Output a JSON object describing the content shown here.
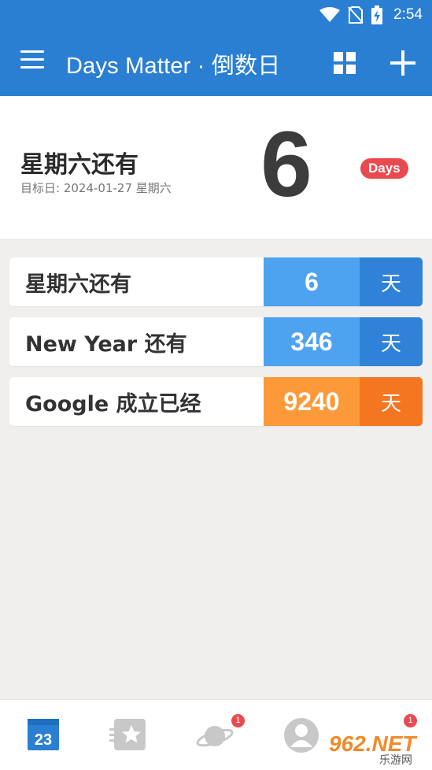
{
  "status_bar": {
    "time": "2:54"
  },
  "app_bar": {
    "title": "Days Matter · 倒数日"
  },
  "hero": {
    "title": "星期六还有",
    "target_date": "目标日: 2024-01-27 星期六",
    "count": "6",
    "badge": "Days"
  },
  "events": [
    {
      "name": "星期六还有",
      "count": "6",
      "unit": "天",
      "color": "#4da3ef"
    },
    {
      "name": "New Year 还有",
      "count": "346",
      "unit": "天",
      "color": "#4da3ef"
    },
    {
      "name": "Google 成立已经",
      "count": "9240",
      "unit": "天",
      "color": "#fc9a3a"
    }
  ],
  "bottom_nav": {
    "calendar_day": "23",
    "discover_badge": "1",
    "profile_badge": "1"
  },
  "watermark": {
    "brand": "962.NET",
    "subtitle": "乐游网"
  },
  "colors": {
    "primary": "#2a7fd3",
    "badge_red": "#e94a4f",
    "count_blue": "#4da3ef",
    "unit_blue": "#2f82d8",
    "count_orange": "#fc9a3a",
    "unit_orange": "#f57621"
  }
}
